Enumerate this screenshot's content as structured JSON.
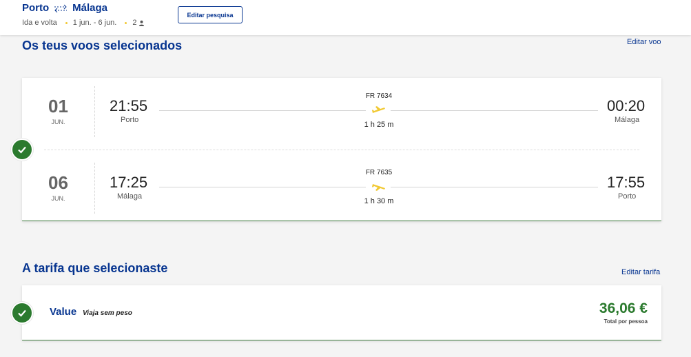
{
  "header": {
    "origin": "Porto",
    "destination": "Málaga",
    "trip_type": "Ida e volta",
    "dates": "1 jun. - 6 jun.",
    "passengers": "2",
    "edit_search_label": "Editar pesquisa",
    "route_icon": "roundtrip-arrows-icon",
    "passenger_icon": "person-icon"
  },
  "flights_section": {
    "title": "Os teus voos selecionados",
    "edit_label": "Editar voo",
    "flights": [
      {
        "day": "01",
        "month": "JUN.",
        "depart_time": "21:55",
        "depart_city": "Porto",
        "flight_number": "FR 7634",
        "duration": "1 h 25 m",
        "arrive_time": "00:20",
        "arrive_city": "Málaga",
        "plane_icon": "plane-takeoff-icon"
      },
      {
        "day": "06",
        "month": "JUN.",
        "depart_time": "17:25",
        "depart_city": "Málaga",
        "flight_number": "FR 7635",
        "duration": "1 h 30 m",
        "arrive_time": "17:55",
        "arrive_city": "Porto",
        "plane_icon": "plane-landing-icon"
      }
    ]
  },
  "fare_section": {
    "title": "A tarifa que selecionaste",
    "edit_label": "Editar tarifa",
    "fare_name": "Value",
    "fare_description": "Viaja sem peso",
    "price": "36,06 €",
    "price_label": "Total por pessoa"
  },
  "colors": {
    "brand_blue": "#073590",
    "success_green": "#2b7a2e",
    "accent_yellow": "#f1c933"
  }
}
